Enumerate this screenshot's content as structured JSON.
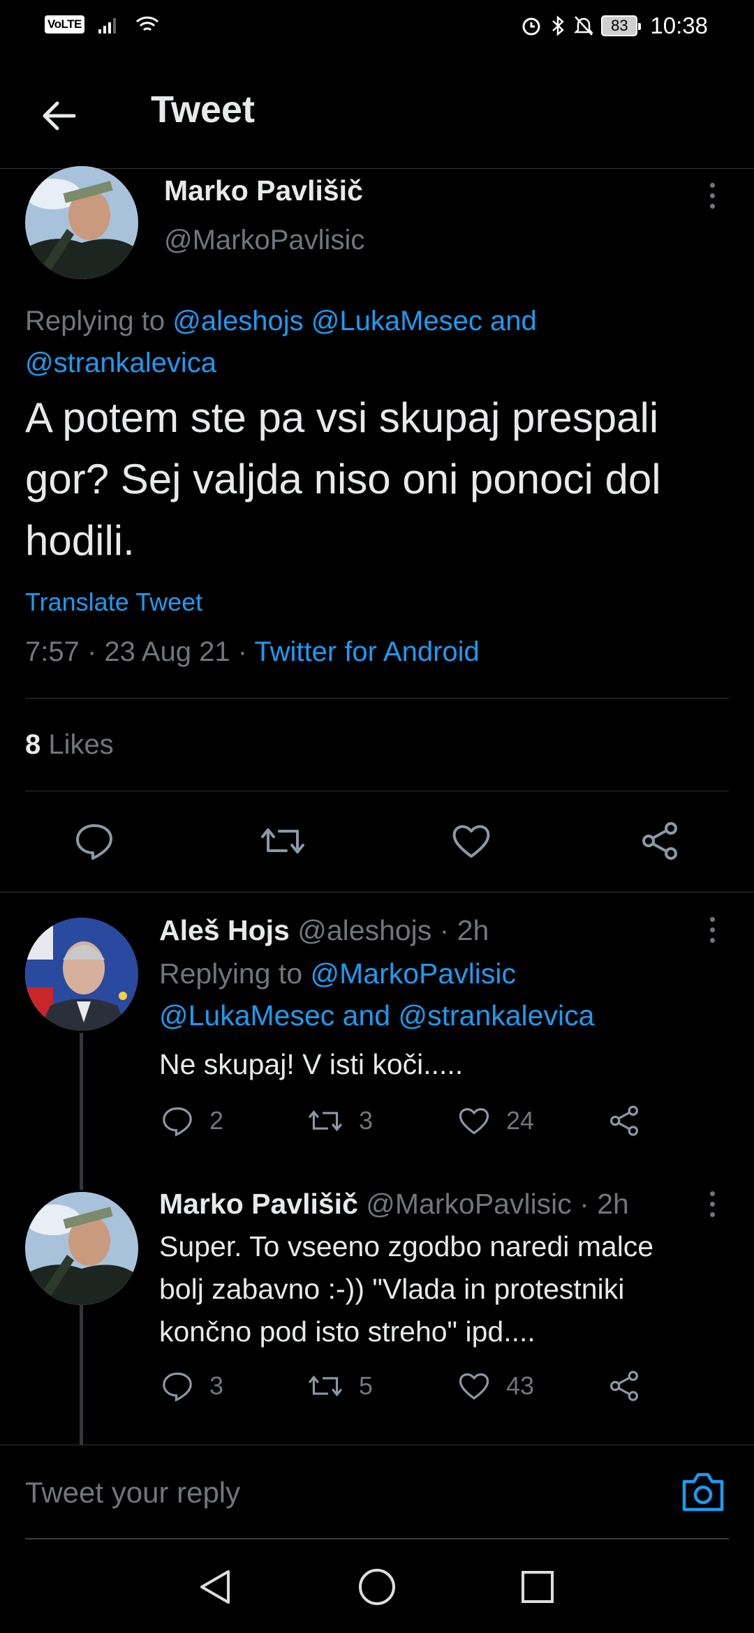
{
  "status_bar": {
    "carrier_badge": "VoLTE",
    "battery": "83",
    "time": "10:38"
  },
  "header": {
    "title": "Tweet"
  },
  "main_tweet": {
    "name": "Marko Pavlišič",
    "handle": "@MarkoPavlisic",
    "replying_prefix": "Replying to",
    "replying_links": [
      "@aleshojs",
      "@LukaMesec and",
      "@strankalevica"
    ],
    "text": "A potem ste pa vsi skupaj prespali gor? Sej valjda niso oni ponoci dol hodili.",
    "translate": "Translate Tweet",
    "time_date": "7:57 · 23 Aug 21 · ",
    "source": "Twitter for Android",
    "likes_count": "8",
    "likes_label": " Likes"
  },
  "replies": [
    {
      "name": "Aleš Hojs",
      "handle_time": " @aleshojs · 2h",
      "replying_prefix": "Replying to ",
      "replying_line1_link": "@MarkoPavlisic",
      "replying_line2_link": "@LukaMesec and @strankalevica",
      "text_lines": [
        "Ne skupaj! V isti koči....."
      ],
      "replies": "2",
      "retweets": "3",
      "likes": "24"
    },
    {
      "name": "Marko Pavlišič",
      "handle_time": " @MarkoPavlisic · 2h",
      "text_lines": [
        "Super. To vseeno zgodbo naredi malce",
        "bolj zabavno :-)) \"Vlada in protestniki",
        "končno pod isto streho\" ipd...."
      ],
      "replies": "3",
      "retweets": "5",
      "likes": "43"
    }
  ],
  "reply_bar": {
    "placeholder": "Tweet your reply"
  },
  "icons": {
    "back": "arrow-left-icon",
    "more": "more-vertical-icon",
    "reply": "comment-icon",
    "retweet": "retweet-icon",
    "like": "heart-icon",
    "share": "share-icon",
    "camera": "camera-icon"
  },
  "colors": {
    "background": "#000000",
    "text": "#e7e9ea",
    "secondary": "#71767b",
    "accent": "#1d9bf0",
    "divider": "#2f3336"
  }
}
